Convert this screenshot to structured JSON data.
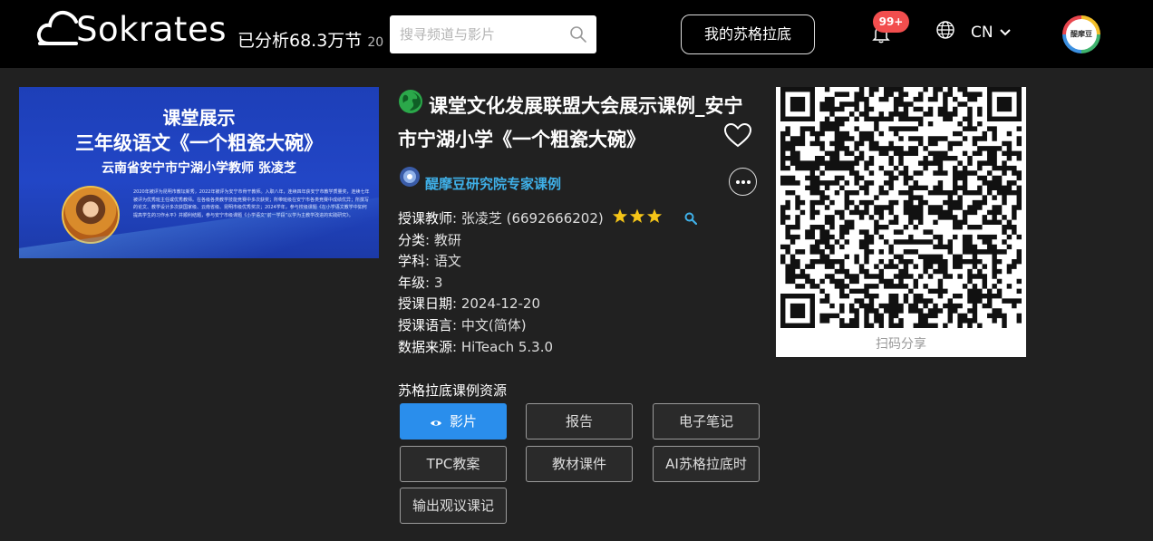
{
  "header": {
    "logo_text": "Sokrates",
    "analyzed_text": "已分析68.3万节",
    "analyzed_tail": "20",
    "search_placeholder": "搜寻频道与影片",
    "my_button": "我的苏格拉底",
    "notification_badge": "99+",
    "language": "CN",
    "avatar_text": "醍摩豆"
  },
  "banner": {
    "line1": "课堂展示",
    "line2": "三年级语文《一个粗瓷大碗》",
    "line3": "云南省安宁市宁湖小学教师 张凌芝",
    "description": "2020年被评为昆明市教坛新秀，2022年被评为安宁市骨干教师。入职八年，连续四年获安宁市教学质量奖，连续七年被评为优秀班主任或优秀教师。在各级各类教学技能竞赛中多次获奖；所带班级在安宁市各类竞赛中成绩优异；所撰写的论文、教学设计多次获国家级、云南省级、昆明市级优秀奖次；2024学年，参与校级课题《在小学语文教学中如何提高学生的习作水平》并顺利结题，参与安宁市级课题《小学语文“前一学段”以学为主教学改进的实践研究》。"
  },
  "lesson": {
    "title": "课堂文化发展联盟大会展示课例_安宁市宁湖小学《一个粗瓷大碗》",
    "org": "醍摩豆研究院专家课例",
    "info": [
      {
        "k": "授课教师",
        "v": "张凌芝 (6692666202)"
      },
      {
        "k": "分类",
        "v": "教研"
      },
      {
        "k": "学科",
        "v": "语文"
      },
      {
        "k": "年级",
        "v": "3"
      },
      {
        "k": "授课日期",
        "v": "2024-12-20"
      },
      {
        "k": "授课语言",
        "v": "中文(简体)"
      },
      {
        "k": "数据来源",
        "v": "HiTeach 5.3.0"
      }
    ],
    "separator": ": ",
    "star_count": 3
  },
  "resources": {
    "title": "苏格拉底课例资源",
    "buttons": [
      "影片",
      "报告",
      "电子笔记",
      "TPC教案",
      "教材课件",
      "AI苏格拉底时",
      "输出观议课记"
    ]
  },
  "qr": {
    "caption": "扫码分享"
  },
  "colors": {
    "accent": "#2a8eec",
    "org_link": "#3fb0e8",
    "badge": "#f24e4e",
    "star": "#f5c518"
  }
}
